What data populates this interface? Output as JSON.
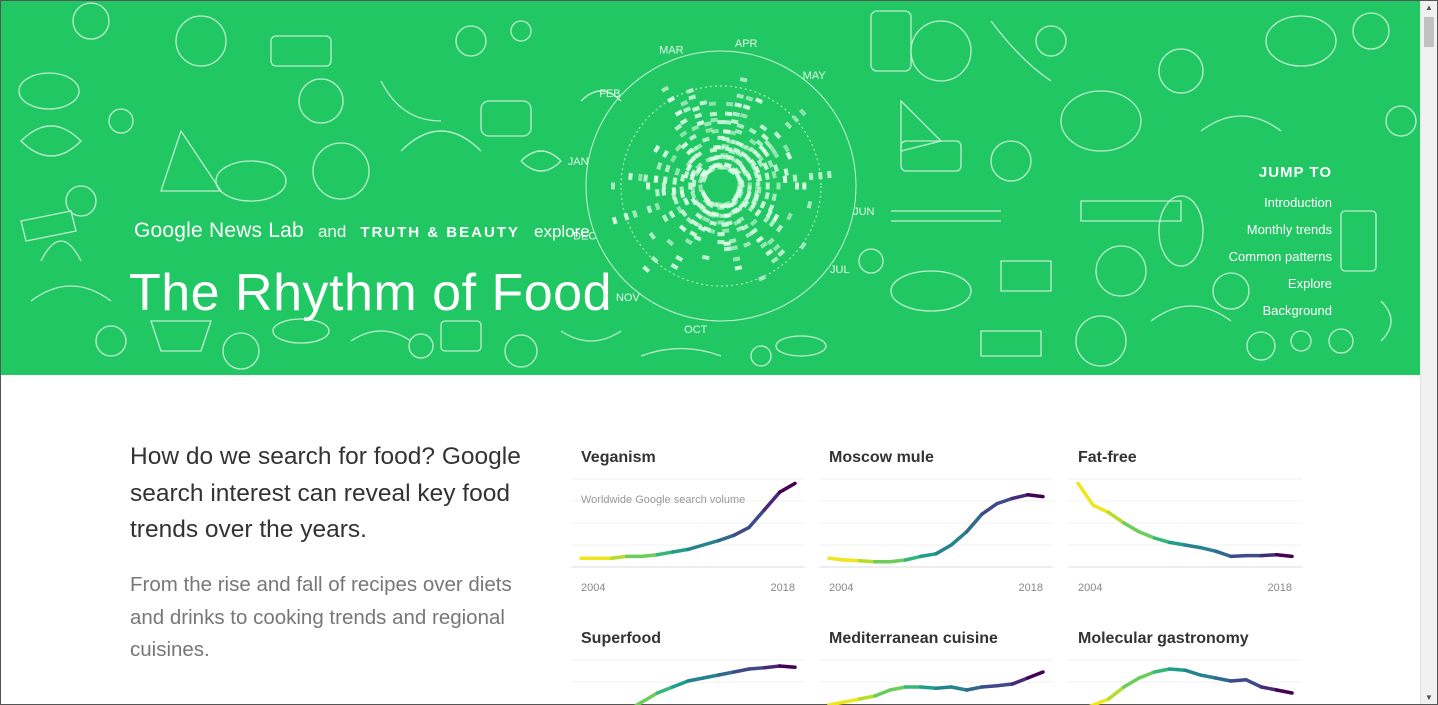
{
  "hero": {
    "brand_gnl": "Google News Lab",
    "brand_and": "and",
    "brand_tb": "TRUTH & BEAUTY",
    "brand_explore": "explore",
    "title": "The Rhythm of Food",
    "background_color": "#21c762",
    "months": [
      "JAN",
      "FEB",
      "MAR",
      "APR",
      "MAY",
      "JUN",
      "JUL",
      "OCT",
      "NOV",
      "DEC"
    ]
  },
  "jump": {
    "title": "JUMP TO",
    "items": [
      "Introduction",
      "Monthly trends",
      "Common patterns",
      "Explore",
      "Background"
    ]
  },
  "intro": {
    "heading": "How do we search for food? Google search interest can reveal key food trends over the years.",
    "paragraph": "From the rise and fall of recipes over diets and drinks to cooking trends and regional cuisines."
  },
  "cards": [
    {
      "title": "Veganism",
      "caption": "Worldwide Google search volume",
      "start": "2004",
      "end": "2018",
      "trend": [
        0.1,
        0.1,
        0.1,
        0.12,
        0.12,
        0.14,
        0.17,
        0.2,
        0.25,
        0.3,
        0.36,
        0.45,
        0.65,
        0.85,
        0.95
      ]
    },
    {
      "title": "Moscow mule",
      "caption": "",
      "start": "2004",
      "end": "2018",
      "trend": [
        0.1,
        0.08,
        0.07,
        0.06,
        0.06,
        0.08,
        0.12,
        0.15,
        0.25,
        0.4,
        0.6,
        0.72,
        0.78,
        0.82,
        0.8
      ]
    },
    {
      "title": "Fat-free",
      "caption": "",
      "start": "2004",
      "end": "2018",
      "trend": [
        0.95,
        0.7,
        0.62,
        0.5,
        0.4,
        0.33,
        0.28,
        0.25,
        0.22,
        0.18,
        0.12,
        0.13,
        0.13,
        0.14,
        0.12
      ]
    },
    {
      "title": "Superfood",
      "caption": "",
      "start": "",
      "end": "",
      "trend": []
    },
    {
      "title": "Mediterranean cuisine",
      "caption": "",
      "start": "",
      "end": "",
      "trend": []
    },
    {
      "title": "Molecular gastronomy",
      "caption": "",
      "start": "",
      "end": "",
      "trend": []
    }
  ]
}
